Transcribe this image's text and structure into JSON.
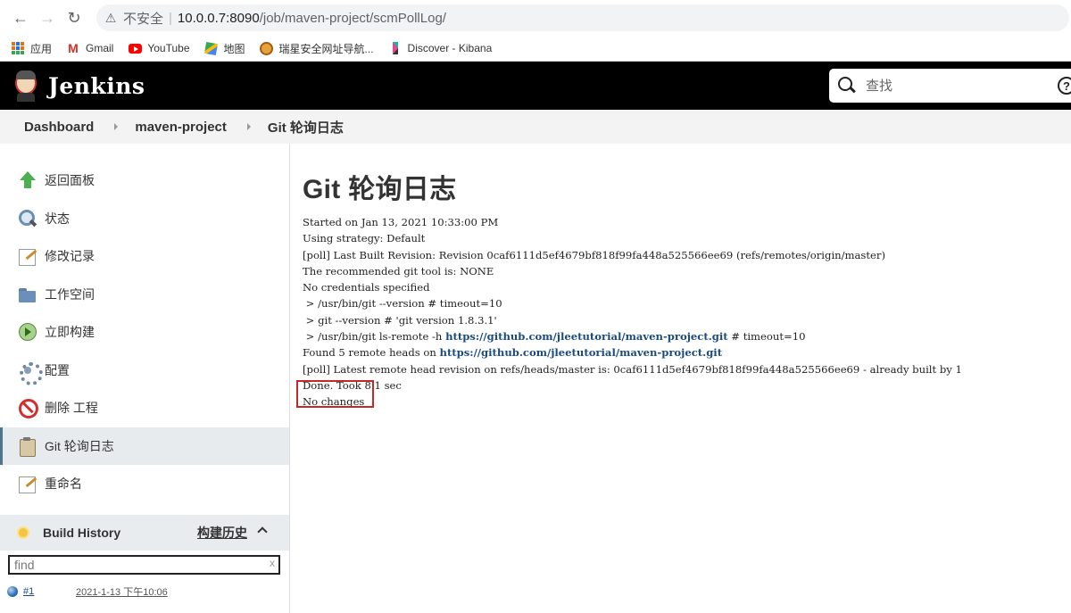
{
  "browser": {
    "insecure_label": "不安全",
    "url_host": "10.0.0.7:8090",
    "url_path": "/job/maven-project/scmPollLog/",
    "bookmarks": [
      {
        "label": "应用",
        "icon": "apps-grid-icon"
      },
      {
        "label": "Gmail",
        "icon": "gmail-icon"
      },
      {
        "label": "YouTube",
        "icon": "youtube-icon"
      },
      {
        "label": "地图",
        "icon": "maps-icon"
      },
      {
        "label": "瑞星安全网址导航...",
        "icon": "lion-icon"
      },
      {
        "label": "Discover - Kibana",
        "icon": "kibana-icon"
      }
    ]
  },
  "header": {
    "title": "Jenkins",
    "search_placeholder": "查找"
  },
  "breadcrumb": [
    "Dashboard",
    "maven-project",
    "Git 轮询日志"
  ],
  "sidebar": {
    "tasks": [
      {
        "label": "返回面板",
        "icon": "up-arrow-icon"
      },
      {
        "label": "状态",
        "icon": "magnifier-icon"
      },
      {
        "label": "修改记录",
        "icon": "notepad-icon"
      },
      {
        "label": "工作空间",
        "icon": "folder-icon"
      },
      {
        "label": "立即构建",
        "icon": "build-icon"
      },
      {
        "label": "配置",
        "icon": "gear-icon"
      },
      {
        "label": "删除 工程",
        "icon": "no-sign-icon"
      },
      {
        "label": "Git 轮询日志",
        "icon": "clipboard-icon",
        "active": true
      },
      {
        "label": "重命名",
        "icon": "notepad-icon"
      }
    ],
    "build_history": {
      "title": "Build History",
      "trend": "构建历史",
      "filter_placeholder": "find",
      "clear": "x",
      "builds": [
        {
          "number": "#1",
          "date": "2021-1-13 下午10:06"
        }
      ]
    }
  },
  "main": {
    "title": "Git 轮询日志",
    "log": {
      "l1": "Started on Jan 13, 2021 10:33:00 PM",
      "l2": "Using strategy: Default",
      "l3": "[poll] Last Built Revision: Revision 0caf6111d5ef4679bf818f99fa448a525566ee69 (refs/remotes/origin/master)",
      "l4": "The recommended git tool is: NONE",
      "l5": "No credentials specified",
      "l6": " > /usr/bin/git --version # timeout=10",
      "l7": " > git --version # 'git version 1.8.3.1'",
      "l8a": " > /usr/bin/git ls-remote -h ",
      "l8link": "https://github.com/jleetutorial/maven-project.git",
      "l8b": " # timeout=10",
      "l9a": "Found 5 remote heads on ",
      "l9link": "https://github.com/jleetutorial/maven-project.git",
      "l10": "[poll] Latest remote head revision on refs/heads/master is: 0caf6111d5ef4679bf818f99fa448a525566ee69 - already built by 1",
      "l11": "Done. Took 8.1 sec",
      "l12": "No changes"
    },
    "highlight_color": "#c62828"
  }
}
